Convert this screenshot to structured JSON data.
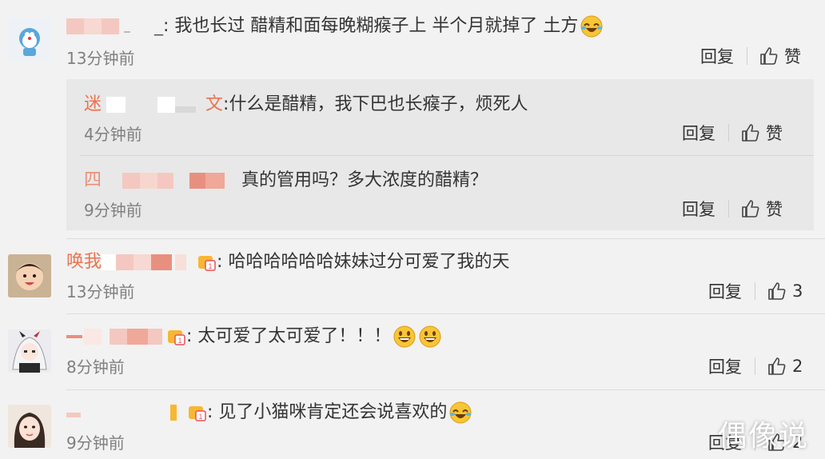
{
  "comments": [
    {
      "name_visible": "_",
      "separator": ":",
      "text": "我也长过 醋精和面每晚糊瘊子上 半个月就掉了 土方",
      "emoji": "laugh-cry-emoji",
      "time": "13分钟前",
      "reply": "回复",
      "like": "赞"
    },
    {
      "name_visible": "唤我",
      "separator": ":",
      "text": "哈哈哈哈哈哈妹妹过分可爱了我的天",
      "time": "13分钟前",
      "reply": "回复",
      "like": "3"
    },
    {
      "name_visible": "",
      "separator": ":",
      "text": "太可爱了太可爱了！！！",
      "emoji": "grin-emoji",
      "time": "8分钟前",
      "reply": "回复",
      "like": "2"
    },
    {
      "name_visible": "",
      "separator": ":",
      "text": "见了小猫咪肯定还会说喜欢的",
      "emoji": "laugh-cry-emoji",
      "time": "9分钟前",
      "reply": "回复",
      "like": "2"
    }
  ],
  "replies": [
    {
      "name_visible": "迷",
      "name_tail": "文",
      "separator": ":",
      "text": "什么是醋精，我下巴也长瘊子，烦死人",
      "time": "4分钟前",
      "reply": "回复",
      "like": "赞"
    },
    {
      "name_visible": "四",
      "separator": "",
      "text": "真的管用吗？多大浓度的醋精？",
      "time": "9分钟前",
      "reply": "回复",
      "like": "赞"
    }
  ],
  "watermark": "偶像说",
  "colors": {
    "background": "#f2f2f2",
    "reply_box": "#e8e8e8",
    "username": "#eb7350",
    "time": "#808080",
    "mosaic_light": "#f4c8c0",
    "mosaic_dark": "#e89080"
  }
}
